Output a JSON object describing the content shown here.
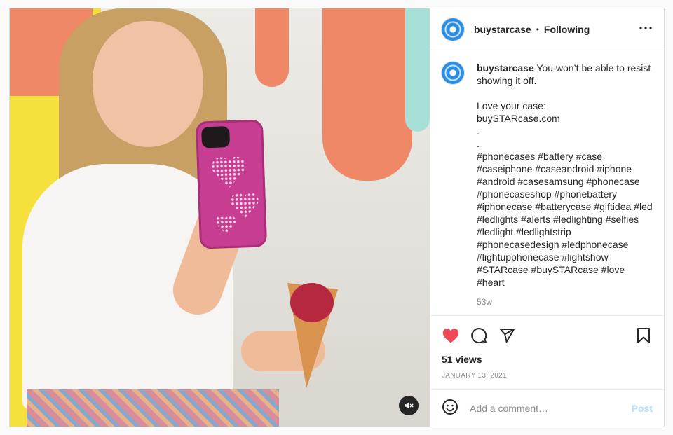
{
  "header": {
    "username": "buystarcase",
    "separator": "•",
    "follow_status": "Following",
    "more_icon": "more-horizontal-icon"
  },
  "caption": {
    "username": "buystarcase",
    "text": "You won’t be able to resist showing it off.\n\nLove your case:\nbuySTARcase.com\n.\n.\n#phonecases #battery #case #caseiphone #caseandroid #iphone #android #casesamsung #phonecase #phonecaseshop #phonebattery #iphonecase #batterycase #giftidea #led #ledlights #alerts #ledlighting #selfies #ledlight #ledlightstrip #phonecasedesign #ledphonecase #lightupphonecase #lightshow #STARcase #buySTARcase #love #heart",
    "age": "53w"
  },
  "actions": {
    "icons": [
      "heart-icon",
      "comment-icon",
      "share-icon",
      "bookmark-icon"
    ],
    "liked": true,
    "like_color": "#ed4956"
  },
  "stats": {
    "views": "51 views",
    "date": "JANUARY 13, 2021"
  },
  "comment_box": {
    "placeholder": "Add a comment…",
    "post_label": "Post",
    "emoji_icon": "emoji-icon"
  },
  "media": {
    "mute_icon": "mute-icon"
  }
}
